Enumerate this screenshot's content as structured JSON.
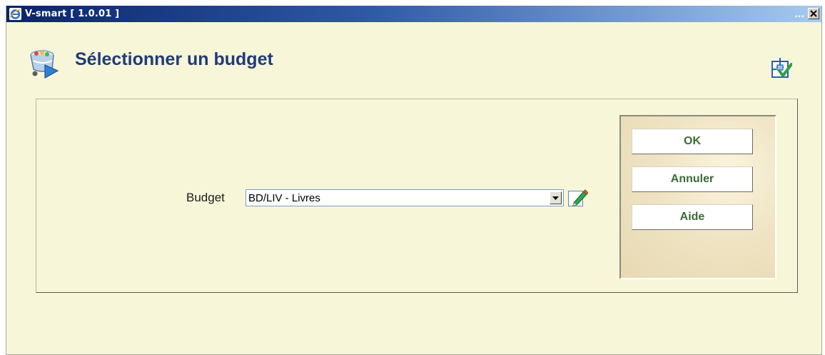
{
  "window": {
    "title": "V-smart [ 1.0.01 ]",
    "minimize_glyph": "...",
    "close_glyph": "✕"
  },
  "header": {
    "title": "Sélectionner un budget",
    "icon": "budget-cart-icon",
    "settings_icon": "settings-icon"
  },
  "form": {
    "budget_label": "Budget",
    "budget_value": "BD/LIV - Livres",
    "edit_icon": "pencil-icon"
  },
  "buttons": {
    "ok": "OK",
    "cancel": "Annuler",
    "help": "Aide"
  },
  "colors": {
    "title_text": "#1f3c78",
    "background": "#f8f6d9",
    "button_text": "#3b6b38"
  }
}
